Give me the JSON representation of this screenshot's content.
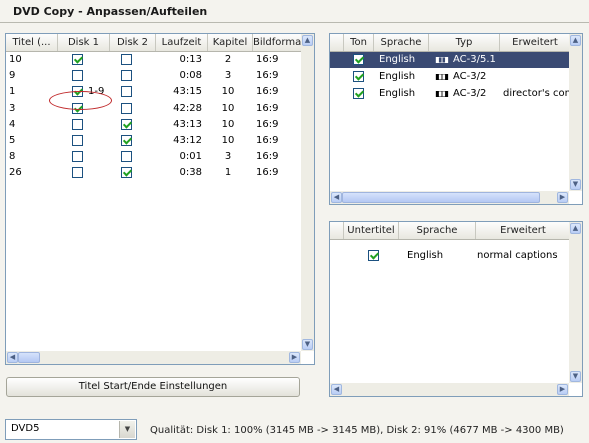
{
  "window": {
    "title": "DVD Copy - Anpassen/Aufteilen"
  },
  "titles_table": {
    "headers": [
      "Titel (...",
      "Disk 1",
      "Disk 2",
      "Laufzeit",
      "Kapitel",
      "Bildformat"
    ],
    "rows": [
      {
        "titel": "10",
        "disk1": true,
        "disk2": false,
        "laufzeit": "0:13",
        "kapitel": "2",
        "format": "16:9"
      },
      {
        "titel": "9",
        "disk1": false,
        "disk2": false,
        "laufzeit": "0:08",
        "kapitel": "3",
        "format": "16:9"
      },
      {
        "titel": "1",
        "disk1": true,
        "disk2": false,
        "laufzeit": "43:15",
        "kapitel": "10",
        "format": "16:9",
        "disk1_range": "1-9"
      },
      {
        "titel": "3",
        "disk1": true,
        "disk2": false,
        "laufzeit": "42:28",
        "kapitel": "10",
        "format": "16:9"
      },
      {
        "titel": "4",
        "disk1": false,
        "disk2": true,
        "laufzeit": "43:13",
        "kapitel": "10",
        "format": "16:9"
      },
      {
        "titel": "5",
        "disk1": false,
        "disk2": true,
        "laufzeit": "43:12",
        "kapitel": "10",
        "format": "16:9"
      },
      {
        "titel": "8",
        "disk1": false,
        "disk2": false,
        "laufzeit": "0:01",
        "kapitel": "3",
        "format": "16:9"
      },
      {
        "titel": "26",
        "disk1": false,
        "disk2": true,
        "laufzeit": "0:38",
        "kapitel": "1",
        "format": "16:9"
      }
    ]
  },
  "audio_table": {
    "headers": [
      "Ton",
      "Sprache",
      "Typ",
      "Erweitert"
    ],
    "rows": [
      {
        "checked": true,
        "sprache": "English",
        "icon": "dolby-digital-icon",
        "typ": "AC-3/5.1",
        "erweitert": "",
        "selected": true
      },
      {
        "checked": true,
        "sprache": "English",
        "icon": "dolby-digital-icon",
        "typ": "AC-3/2",
        "erweitert": "",
        "selected": false
      },
      {
        "checked": true,
        "sprache": "English",
        "icon": "dolby-digital-icon",
        "typ": "AC-3/2",
        "erweitert": "director's comm",
        "selected": false
      }
    ]
  },
  "subtitle_table": {
    "headers": [
      "Untertitel",
      "Sprache",
      "Erweitert"
    ],
    "rows": [
      {
        "checked": true,
        "sprache": "English",
        "erweitert": "normal captions"
      }
    ]
  },
  "buttons": {
    "title_settings": "Titel Start/Ende Einstellungen"
  },
  "target": {
    "selected": "DVD5"
  },
  "status": {
    "quality": "Qualität: Disk 1: 100% (3145 MB -> 3145 MB), Disk 2: 91% (4677 MB -> 4300 MB)"
  },
  "colors": {
    "selection": "#3a4a73",
    "check": "#21a121",
    "highlight_ellipse": "#c0282a",
    "panel_border": "#7f9db9"
  }
}
